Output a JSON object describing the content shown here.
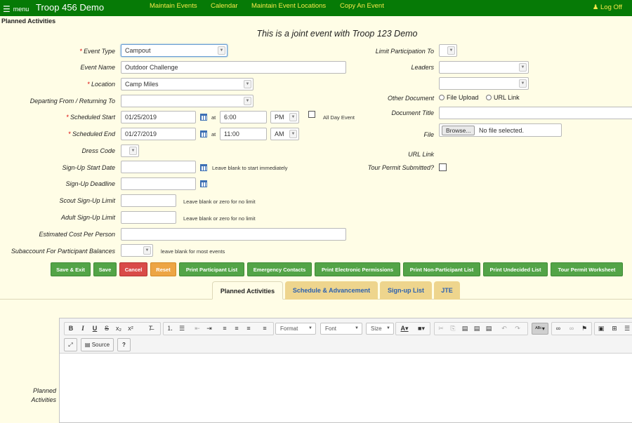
{
  "topbar": {
    "menu_label": "menu",
    "brand": "Troop 456 Demo",
    "nav": [
      "Maintain Events",
      "Calendar",
      "Maintain Event Locations",
      "Copy An Event"
    ],
    "logoff": "Log Off"
  },
  "page": {
    "title": "Planned Activities",
    "joint_note": "This is a joint event with Troop 123 Demo"
  },
  "form": {
    "event_type": {
      "label": "Event Type",
      "value": "Campout"
    },
    "event_name": {
      "label": "Event Name",
      "value": "Outdoor Challenge"
    },
    "location": {
      "label": "Location",
      "value": "Camp Miles"
    },
    "departing": {
      "label": "Departing From / Returning To",
      "value": ""
    },
    "start": {
      "label": "Scheduled Start",
      "date": "01/25/2019",
      "at": "at",
      "time": "6:00",
      "ampm": "PM"
    },
    "all_day": "All Day Event",
    "end": {
      "label": "Scheduled End",
      "date": "01/27/2019",
      "at": "at",
      "time": "11:00",
      "ampm": "AM"
    },
    "dress_code": {
      "label": "Dress Code"
    },
    "signup_start": {
      "label": "Sign-Up Start Date",
      "hint": "Leave blank to start immediately"
    },
    "signup_deadline": {
      "label": "Sign-Up Deadline"
    },
    "scout_limit": {
      "label": "Scout Sign-Up Limit",
      "hint": "Leave blank or zero for no limit"
    },
    "adult_limit": {
      "label": "Adult Sign-Up Limit",
      "hint": "Leave blank or zero for no limit"
    },
    "cost": {
      "label": "Estimated Cost Per Person"
    },
    "subaccount": {
      "label": "Subaccount For Participant Balances",
      "hint": "leave blank for most events"
    }
  },
  "right": {
    "limit_participation": "Limit Participation To",
    "leaders": "Leaders",
    "other_document": "Other Document",
    "file_upload": "File Upload",
    "url_link_radio": "URL Link",
    "document_title": "Document Title",
    "file": "File",
    "browse": "Browse...",
    "no_file": "No file selected.",
    "url_link": "URL Link",
    "tour_permit": "Tour Permit Submitted?"
  },
  "buttons": [
    "Save & Exit",
    "Save",
    "Cancel",
    "Reset",
    "Print Participant List",
    "Emergency Contacts",
    "Print Electronic Permissions",
    "Print Non-Participant List",
    "Print Undecided List",
    "Tour Permit Worksheet"
  ],
  "tabs": [
    "Planned Activities",
    "Schedule & Advancement",
    "Sign-up List",
    "JTE"
  ],
  "editor": {
    "format": "Format",
    "font": "Font",
    "size": "Size",
    "source": "Source",
    "help": "?",
    "field_label_1": "Planned",
    "field_label_2": "Activities"
  }
}
